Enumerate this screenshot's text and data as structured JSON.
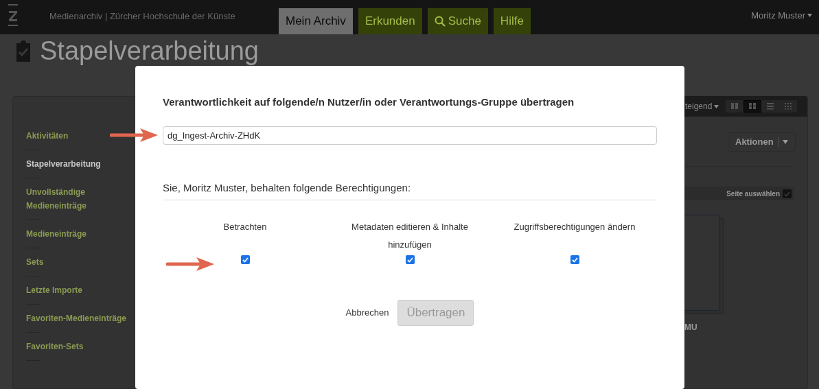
{
  "header": {
    "site_title": "Medienarchiv | Zürcher Hochschule der Künste",
    "user_menu": "Moritz Muster",
    "tabs": [
      {
        "label": "Mein Archiv",
        "selected": true,
        "kind": "text"
      },
      {
        "label": "Erkunden",
        "selected": false,
        "kind": "text"
      },
      {
        "label": "Suche",
        "selected": false,
        "kind": "search"
      },
      {
        "label": "Hilfe",
        "selected": false,
        "kind": "text"
      }
    ]
  },
  "page": {
    "title": "Stapelverarbeitung",
    "sidebar": {
      "items": [
        {
          "label": "Aktivitäten",
          "selected": false
        },
        {
          "label": "Stapelverarbeitung",
          "selected": true
        },
        {
          "label": "Unvollständige Medieneinträge",
          "selected": false
        },
        {
          "label": "Medieneinträge",
          "selected": false
        },
        {
          "label": "Sets",
          "selected": false
        },
        {
          "label": "Letzte Importe",
          "selected": false
        },
        {
          "label": "Favoriten-Medieneinträge",
          "selected": false
        },
        {
          "label": "Favoriten-Sets",
          "selected": false
        }
      ]
    },
    "toolbar": {
      "sort_label": "teigend",
      "view_modes": [
        {
          "kind": "columns",
          "selected": false
        },
        {
          "kind": "grid",
          "selected": true
        },
        {
          "kind": "list",
          "selected": false
        },
        {
          "kind": "tiles",
          "selected": false
        }
      ]
    },
    "actions_button": "Aktionen",
    "select_page": {
      "label": "Seite auswählen",
      "checked": true
    },
    "media_caption": "MU"
  },
  "dialog": {
    "title": "Verantwortlichkeit auf folgende/n Nutzer/in oder Verantwortungs-Gruppe übertragen",
    "recipient_value": "dg_Ingest-Archiv-ZHdK",
    "permissions_heading": "Sie, Moritz Muster, behalten folgende Berechtigungen:",
    "permissions": [
      {
        "label": "Betrachten",
        "checked": true
      },
      {
        "label": "Metadaten editieren & Inhalte hinzufügen",
        "checked": true
      },
      {
        "label": "Zugriffsberechtigungen ändern",
        "checked": true
      }
    ],
    "cancel": "Abbrechen",
    "submit": {
      "label": "Übertragen",
      "disabled": true
    }
  }
}
